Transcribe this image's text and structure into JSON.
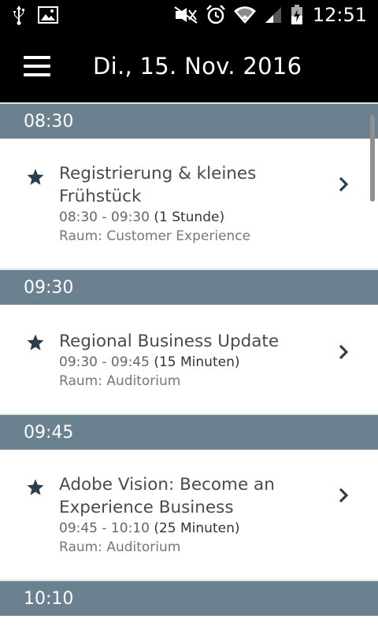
{
  "status_bar": {
    "time": "12:51",
    "icons": [
      "usb-icon",
      "image-icon",
      "mute-icon",
      "alarm-icon",
      "wifi-icon",
      "signal-icon",
      "battery-charging-icon"
    ]
  },
  "app_bar": {
    "menu_icon": "menu-icon",
    "title": "Di., 15. Nov. 2016"
  },
  "agenda": {
    "groups": [
      {
        "time": "08:30",
        "session": {
          "title_line1": "Registrierung & kleines",
          "title_line2": "Frühstück",
          "time_range": "08:30 - 09:30",
          "duration": "(1 Stunde)",
          "room": "Raum: Customer Experience"
        }
      },
      {
        "time": "09:30",
        "session": {
          "title_line1": "Regional Business Update",
          "time_range": "09:30 - 09:45",
          "duration": "(15 Minuten)",
          "room": "Raum: Auditorium"
        }
      },
      {
        "time": "09:45",
        "session": {
          "title_line1": "Adobe Vision: Become an",
          "title_line2": "Experience Business",
          "time_range": "09:45 - 10:10",
          "duration": "(25 Minuten)",
          "room": "Raum: Auditorium"
        }
      },
      {
        "time": "10:10"
      }
    ]
  },
  "colors": {
    "app_bar": "#000000",
    "section_header": "#6b8190",
    "star": "#2b3f4e",
    "chevron": "#2b3f4e"
  }
}
